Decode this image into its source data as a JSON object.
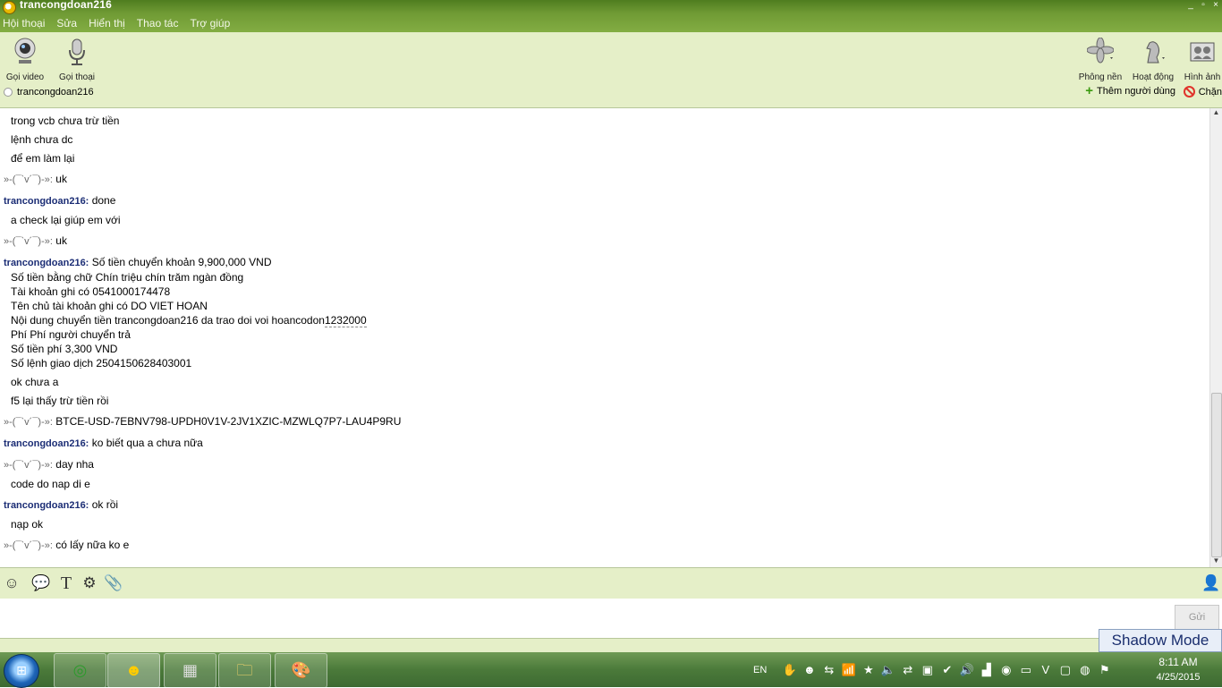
{
  "window": {
    "title": "trancongdoan216",
    "controls": [
      "_",
      "▫",
      "×"
    ]
  },
  "menu": [
    "Hội thoại",
    "Sửa",
    "Hiển thị",
    "Thao tác",
    "Trợ giúp"
  ],
  "toolbar": {
    "video_call": "Gọi video",
    "voice_call": "Gọi thoại",
    "background": "Phông nền",
    "activity": "Hoạt động",
    "photos": "Hình ảnh",
    "contact_name": "trancongdoan216",
    "add_user": "Thêm người dùng",
    "block": "Chặn"
  },
  "chat": {
    "messages": [
      {
        "sender": "",
        "text": "trong vcb chưa trừ tiền"
      },
      {
        "sender": "",
        "text": "lệnh chưa dc"
      },
      {
        "sender": "",
        "text": "để em làm lại"
      },
      {
        "sender": "»-(¯`v´¯)-»:",
        "text": "uk"
      },
      {
        "sender": "trancongdoan216:",
        "text": "done"
      },
      {
        "sender": "",
        "text": "a check lại giúp em với"
      },
      {
        "sender": "»-(¯`v´¯)-»:",
        "text": "uk"
      },
      {
        "sender": "trancongdoan216:",
        "text": "Số tiền chuyển khoản 9,900,000 VND"
      },
      {
        "sender": "",
        "lines": [
          "Số tiền bằng chữ Chín triệu chín trăm ngàn đồng",
          "Tài khoản ghi có 0541000174478",
          "Tên chủ tài khoản ghi có DO VIET HOAN",
          "Nội dung chuyển tiền trancongdoan216 da trao doi voi hoancodon",
          "Phí Phí người chuyển trả",
          "Số tiền phí 3,300 VND",
          "Số lệnh giao dịch 2504150628403001"
        ],
        "dashed_suffix": "1232000"
      },
      {
        "sender": "",
        "text": "ok chưa a"
      },
      {
        "sender": "",
        "text": "f5 lại thấy trừ tiền rồi"
      },
      {
        "sender": "»-(¯`v´¯)-»:",
        "text": "BTCE-USD-7EBNV798-UPDH0V1V-2JV1XZIC-MZWLQ7P7-LAU4P9RU"
      },
      {
        "sender": "trancongdoan216:",
        "text": "ko biết qua a chưa nữa"
      },
      {
        "sender": "»-(¯`v´¯)-»:",
        "text": "day nha"
      },
      {
        "sender": "",
        "text": "code do nap di e"
      },
      {
        "sender": "trancongdoan216:",
        "text": "ok rồi"
      },
      {
        "sender": "",
        "text": "nạp ok"
      },
      {
        "sender": "»-(¯`v´¯)-»:",
        "text": "có lấy nữa ko e"
      }
    ]
  },
  "input": {
    "send_label": "Gửi",
    "value": ""
  },
  "overlay": {
    "shadow_mode": "Shadow Mode"
  },
  "taskbar": {
    "lang": "EN",
    "time": "8:11 AM",
    "date": "4/25/2015"
  },
  "colors": {
    "green_bar": "#e5efc8",
    "sender_blue": "#1b2d75",
    "title_green": "#6f9a34"
  }
}
